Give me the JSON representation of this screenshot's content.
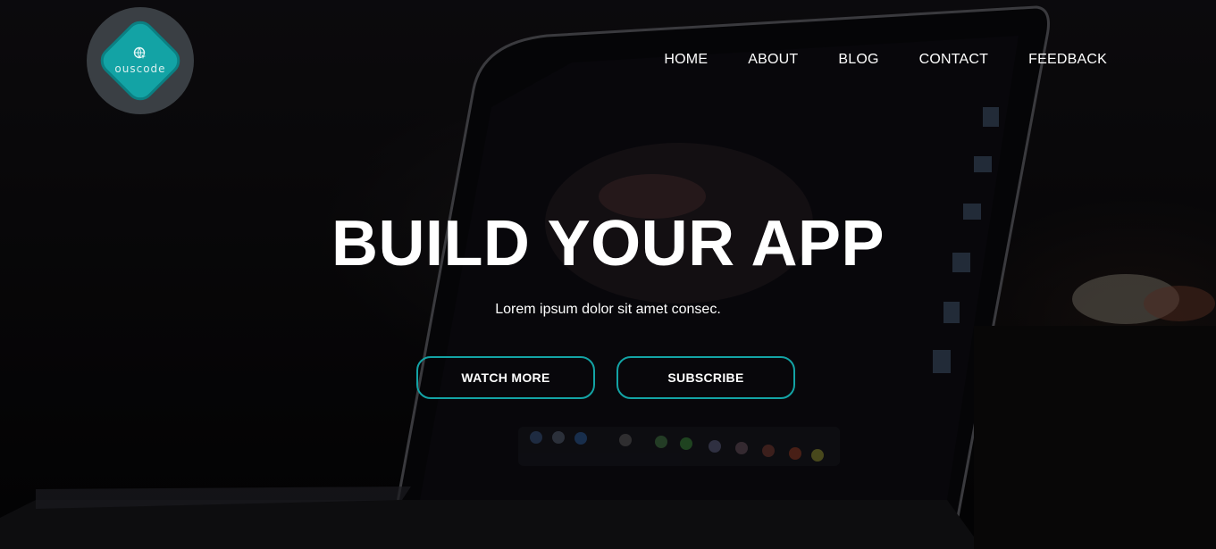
{
  "brand": {
    "logo_text": "ouscode",
    "logo_color": "#13a3a5",
    "logo_icon": "globe-cursor-icon"
  },
  "nav": {
    "items": [
      "HOME",
      "ABOUT",
      "BLOG",
      "CONTACT",
      "FEEDBACK"
    ]
  },
  "hero": {
    "title": "BUILD YOUR APP",
    "subtitle": "Lorem ipsum dolor sit amet consec.",
    "buttons": {
      "watch_more": "WATCH MORE",
      "subscribe": "SUBSCRIBE"
    },
    "accent_color": "#13a3a5",
    "background_image": "dark-laptop-photo"
  }
}
